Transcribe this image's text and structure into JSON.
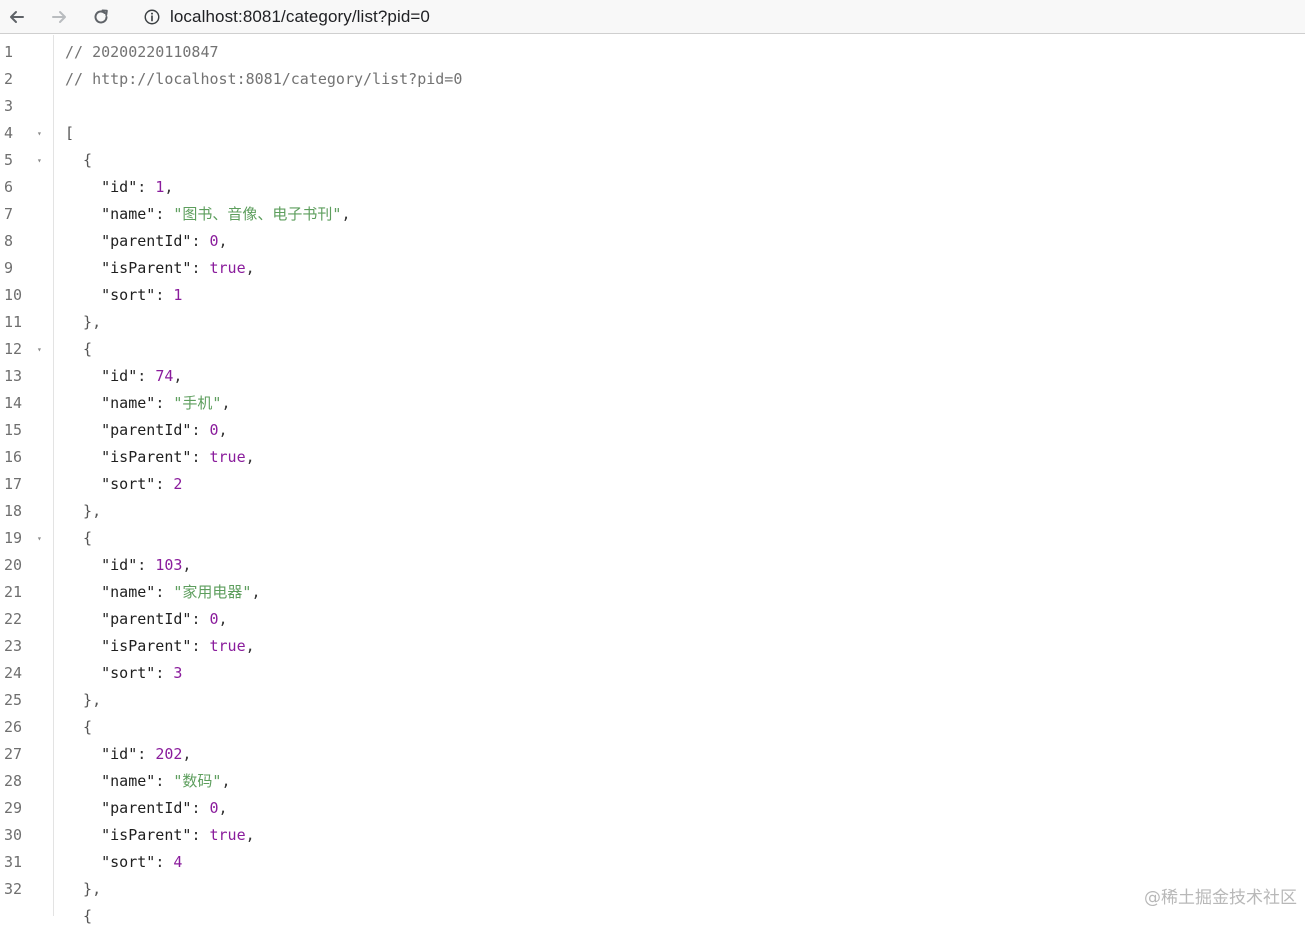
{
  "browser": {
    "url": "localhost:8081/category/list?pid=0",
    "icons": {
      "back": "arrow-left-icon",
      "forward": "arrow-right-icon",
      "reload": "reload-icon",
      "info": "info-icon"
    }
  },
  "viewer": {
    "lines": [
      {
        "n": "1",
        "fold": "",
        "parts": [
          [
            "c-comment",
            "// 20200220110847"
          ]
        ]
      },
      {
        "n": "2",
        "fold": "",
        "parts": [
          [
            "c-comment",
            "// http://localhost:8081/category/list?pid=0"
          ]
        ]
      },
      {
        "n": "3",
        "fold": "",
        "parts": []
      },
      {
        "n": "4",
        "fold": "▾",
        "parts": [
          [
            "c-bracket",
            "["
          ]
        ]
      },
      {
        "n": "5",
        "fold": "▾",
        "parts": [
          [
            "c-bracket",
            "  {"
          ]
        ]
      },
      {
        "n": "6",
        "fold": "",
        "parts": [
          [
            "c-key",
            "    \"id\""
          ],
          [
            "c-punc",
            ": "
          ],
          [
            "c-num",
            "1"
          ],
          [
            "c-punc",
            ","
          ]
        ]
      },
      {
        "n": "7",
        "fold": "",
        "parts": [
          [
            "c-key",
            "    \"name\""
          ],
          [
            "c-punc",
            ": "
          ],
          [
            "c-str",
            "\"图书、音像、电子书刊\""
          ],
          [
            "c-punc",
            ","
          ]
        ]
      },
      {
        "n": "8",
        "fold": "",
        "parts": [
          [
            "c-key",
            "    \"parentId\""
          ],
          [
            "c-punc",
            ": "
          ],
          [
            "c-num",
            "0"
          ],
          [
            "c-punc",
            ","
          ]
        ]
      },
      {
        "n": "9",
        "fold": "",
        "parts": [
          [
            "c-key",
            "    \"isParent\""
          ],
          [
            "c-punc",
            ": "
          ],
          [
            "c-bool",
            "true"
          ],
          [
            "c-punc",
            ","
          ]
        ]
      },
      {
        "n": "10",
        "fold": "",
        "parts": [
          [
            "c-key",
            "    \"sort\""
          ],
          [
            "c-punc",
            ": "
          ],
          [
            "c-num",
            "1"
          ]
        ]
      },
      {
        "n": "11",
        "fold": "",
        "parts": [
          [
            "c-bracket",
            "  },"
          ]
        ]
      },
      {
        "n": "12",
        "fold": "▾",
        "parts": [
          [
            "c-bracket",
            "  {"
          ]
        ]
      },
      {
        "n": "13",
        "fold": "",
        "parts": [
          [
            "c-key",
            "    \"id\""
          ],
          [
            "c-punc",
            ": "
          ],
          [
            "c-num",
            "74"
          ],
          [
            "c-punc",
            ","
          ]
        ]
      },
      {
        "n": "14",
        "fold": "",
        "parts": [
          [
            "c-key",
            "    \"name\""
          ],
          [
            "c-punc",
            ": "
          ],
          [
            "c-str",
            "\"手机\""
          ],
          [
            "c-punc",
            ","
          ]
        ]
      },
      {
        "n": "15",
        "fold": "",
        "parts": [
          [
            "c-key",
            "    \"parentId\""
          ],
          [
            "c-punc",
            ": "
          ],
          [
            "c-num",
            "0"
          ],
          [
            "c-punc",
            ","
          ]
        ]
      },
      {
        "n": "16",
        "fold": "",
        "parts": [
          [
            "c-key",
            "    \"isParent\""
          ],
          [
            "c-punc",
            ": "
          ],
          [
            "c-bool",
            "true"
          ],
          [
            "c-punc",
            ","
          ]
        ]
      },
      {
        "n": "17",
        "fold": "",
        "parts": [
          [
            "c-key",
            "    \"sort\""
          ],
          [
            "c-punc",
            ": "
          ],
          [
            "c-num",
            "2"
          ]
        ]
      },
      {
        "n": "18",
        "fold": "",
        "parts": [
          [
            "c-bracket",
            "  },"
          ]
        ]
      },
      {
        "n": "19",
        "fold": "▾",
        "parts": [
          [
            "c-bracket",
            "  {"
          ]
        ]
      },
      {
        "n": "20",
        "fold": "",
        "parts": [
          [
            "c-key",
            "    \"id\""
          ],
          [
            "c-punc",
            ": "
          ],
          [
            "c-num",
            "103"
          ],
          [
            "c-punc",
            ","
          ]
        ]
      },
      {
        "n": "21",
        "fold": "",
        "parts": [
          [
            "c-key",
            "    \"name\""
          ],
          [
            "c-punc",
            ": "
          ],
          [
            "c-str",
            "\"家用电器\""
          ],
          [
            "c-punc",
            ","
          ]
        ]
      },
      {
        "n": "22",
        "fold": "",
        "parts": [
          [
            "c-key",
            "    \"parentId\""
          ],
          [
            "c-punc",
            ": "
          ],
          [
            "c-num",
            "0"
          ],
          [
            "c-punc",
            ","
          ]
        ]
      },
      {
        "n": "23",
        "fold": "",
        "parts": [
          [
            "c-key",
            "    \"isParent\""
          ],
          [
            "c-punc",
            ": "
          ],
          [
            "c-bool",
            "true"
          ],
          [
            "c-punc",
            ","
          ]
        ]
      },
      {
        "n": "24",
        "fold": "",
        "parts": [
          [
            "c-key",
            "    \"sort\""
          ],
          [
            "c-punc",
            ": "
          ],
          [
            "c-num",
            "3"
          ]
        ]
      },
      {
        "n": "25",
        "fold": "",
        "parts": [
          [
            "c-bracket",
            "  },"
          ]
        ]
      },
      {
        "n": "26",
        "fold": "",
        "parts": [
          [
            "c-bracket",
            "  {"
          ]
        ]
      },
      {
        "n": "27",
        "fold": "",
        "parts": [
          [
            "c-key",
            "    \"id\""
          ],
          [
            "c-punc",
            ": "
          ],
          [
            "c-num",
            "202"
          ],
          [
            "c-punc",
            ","
          ]
        ]
      },
      {
        "n": "28",
        "fold": "",
        "parts": [
          [
            "c-key",
            "    \"name\""
          ],
          [
            "c-punc",
            ": "
          ],
          [
            "c-str",
            "\"数码\""
          ],
          [
            "c-punc",
            ","
          ]
        ]
      },
      {
        "n": "29",
        "fold": "",
        "parts": [
          [
            "c-key",
            "    \"parentId\""
          ],
          [
            "c-punc",
            ": "
          ],
          [
            "c-num",
            "0"
          ],
          [
            "c-punc",
            ","
          ]
        ]
      },
      {
        "n": "30",
        "fold": "",
        "parts": [
          [
            "c-key",
            "    \"isParent\""
          ],
          [
            "c-punc",
            ": "
          ],
          [
            "c-bool",
            "true"
          ],
          [
            "c-punc",
            ","
          ]
        ]
      },
      {
        "n": "31",
        "fold": "",
        "parts": [
          [
            "c-key",
            "    \"sort\""
          ],
          [
            "c-punc",
            ": "
          ],
          [
            "c-num",
            "4"
          ]
        ]
      },
      {
        "n": "32",
        "fold": "",
        "parts": [
          [
            "c-bracket",
            "  },"
          ]
        ]
      },
      {
        "n": "",
        "fold": "",
        "parts": [
          [
            "c-bracket",
            "  {"
          ]
        ]
      }
    ]
  },
  "watermark": "@稀土掘金技术社区",
  "colors": {
    "number": "#8a1c9c",
    "string": "#5d9e5d",
    "comment": "#737373"
  }
}
